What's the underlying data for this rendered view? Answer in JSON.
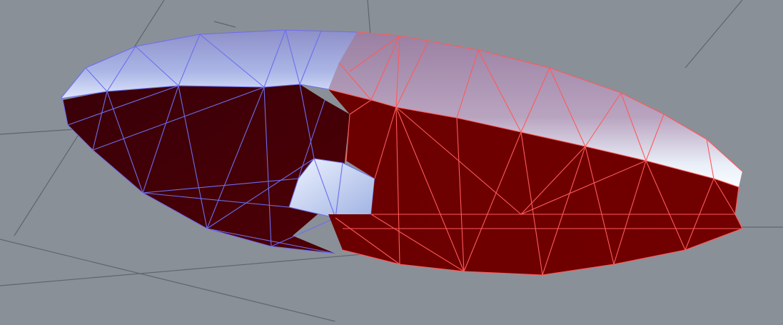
{
  "viewport": {
    "background": "#8a9098",
    "grid_color": "#5f656c",
    "mesh_left_color": "#6d6df0",
    "mesh_right_color": "#ff5a5a",
    "interior_color": "#6e0000"
  },
  "scene": {
    "objects": [
      {
        "name": "mesh-part-left",
        "color_key": "mesh_left_color"
      },
      {
        "name": "mesh-part-right",
        "color_key": "mesh_right_color"
      }
    ]
  }
}
